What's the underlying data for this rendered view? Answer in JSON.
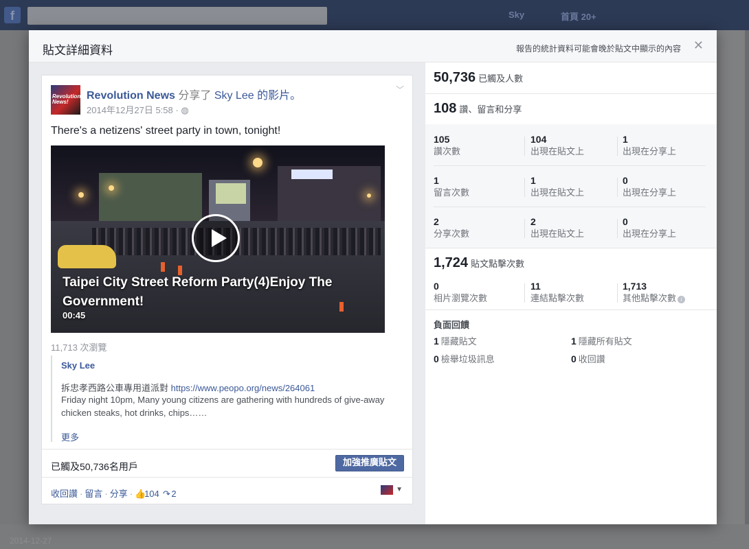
{
  "dialog": {
    "title": "貼文詳細資料",
    "note": "報告的統計資料可能會晚於貼文中顯示的內容",
    "close": "✕"
  },
  "post": {
    "page_name": "Revolution News",
    "shared_text": " 分享了 ",
    "shared_user": "Sky Lee",
    "shared_suffix": " 的影片。",
    "avatar_text": "Revolution News!",
    "timestamp": "2014年12月27日 5:58 · ",
    "privacy_icon": "globe-icon",
    "text": "There's a netizens' street party in town, tonight!",
    "video": {
      "title": "Taipei City Street Reform Party(4)Enjoy The Government!",
      "duration": "00:45"
    },
    "views": "11,713 次瀏覽",
    "quote": {
      "author": "Sky Lee",
      "line_prefix": "拆忠孝西路公車專用道派對 ",
      "link": "https://www.peopo.org/news/264061",
      "body": "Friday night 10pm, Many young citizens are gathering with hundreds of give-away chicken steaks, hot drinks, chips……",
      "more": "更多"
    },
    "reach_text": "已觸及50,736名用戶",
    "boost_button": "加強推廣貼文",
    "actions": {
      "unlike": "收回讚",
      "comment": "留言",
      "share": "分享",
      "separator": "·",
      "likes": "104",
      "shares": "2"
    }
  },
  "stats": {
    "reach": {
      "value": "50,736",
      "label": "已觸及人數"
    },
    "engagement": {
      "value": "108",
      "label": "讚、留言和分享"
    },
    "rows": [
      {
        "cells": [
          {
            "num": "105",
            "label": "讚次數"
          },
          {
            "num": "104",
            "label": "出現在貼文上"
          },
          {
            "num": "1",
            "label": "出現在分享上"
          }
        ]
      },
      {
        "cells": [
          {
            "num": "1",
            "label": "留言次數"
          },
          {
            "num": "1",
            "label": "出現在貼文上"
          },
          {
            "num": "0",
            "label": "出現在分享上"
          }
        ]
      },
      {
        "cells": [
          {
            "num": "2",
            "label": "分享次數"
          },
          {
            "num": "2",
            "label": "出現在貼文上"
          },
          {
            "num": "0",
            "label": "出現在分享上"
          }
        ]
      }
    ],
    "clicks": {
      "value": "1,724",
      "label": "貼文點擊次數"
    },
    "click_cells": [
      {
        "num": "0",
        "label": "相片瀏覽次數"
      },
      {
        "num": "11",
        "label": "連結點擊次數"
      },
      {
        "num": "1,713",
        "label": "其他點擊次數"
      }
    ],
    "negative": {
      "title": "負面回饋",
      "items": [
        {
          "num": "1",
          "label": "隱藏貼文"
        },
        {
          "num": "1",
          "label": "隱藏所有貼文"
        },
        {
          "num": "0",
          "label": "檢舉垃圾訊息"
        },
        {
          "num": "0",
          "label": "收回讚"
        }
      ]
    }
  },
  "background": {
    "user": "Sky",
    "home": "首頁 20+",
    "footer_date": "2014-12-27"
  }
}
